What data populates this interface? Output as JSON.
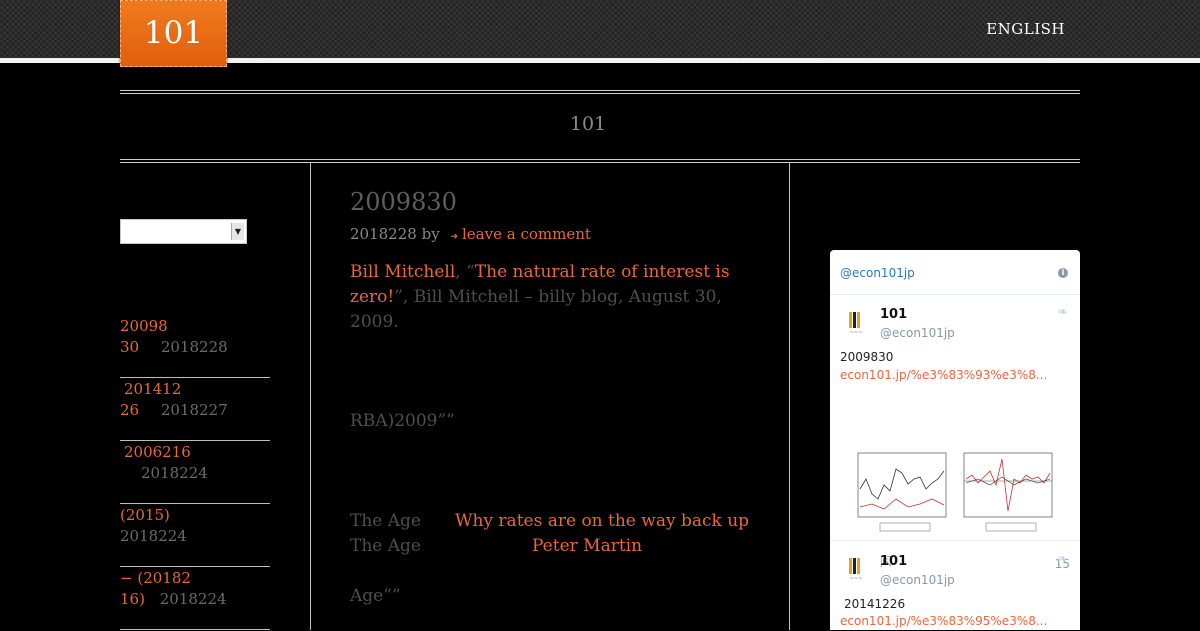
{
  "header": {
    "logo_text": "101",
    "language_link": "ENGLISH"
  },
  "site": {
    "title": "101"
  },
  "sidebar": {
    "categories_select": "",
    "recent_posts": [
      {
        "line1": "20098",
        "line2": "30",
        "date": "2018228"
      },
      {
        "line1": "201412",
        "line2": "26",
        "date": "2018227"
      },
      {
        "line1": "2006216",
        "line2": "",
        "date": "2018224"
      },
      {
        "line1": "(2015)",
        "line2": "",
        "date": "2018224"
      },
      {
        "line1": "− (20182",
        "line2": "16)",
        "date": "2018224"
      }
    ]
  },
  "post": {
    "title": "2009830",
    "meta_date": "2018228",
    "meta_by": "by",
    "meta_comment": "leave a comment",
    "p1_author": "Bill Mitchell",
    "p1_sep": ", “",
    "p1_link": "The natural rate of interest is zero!",
    "p1_rest": "”, Bill Mitchell – billy blog, August 30, 2009.",
    "p2": "RBA)2009””",
    "p3_source1": "The Age",
    "p3_link1": "Why rates are on the way back up",
    "p3_source2": "The Age",
    "p3_link2": "Peter Martin",
    "p4": "Age””"
  },
  "twitter": {
    "header_handle": "@econ101jp",
    "tweets": [
      {
        "name": "101",
        "handle": "@econ101jp",
        "text": "2009830",
        "link": "econ101.jp/%e3%83%93%e3%8...",
        "likes": "15"
      },
      {
        "name": "101",
        "handle": "@econ101jp",
        "text": "20141226",
        "link": "econ101.jp/%e3%83%95%e3%8..."
      }
    ]
  },
  "colors": {
    "accent": "#e8673c",
    "logo_orange": "#e86a16",
    "twitter_blue": "#2b7bb9"
  },
  "icons": [
    "pin-icon",
    "info-icon",
    "twitter-bird-icon",
    "heart-icon",
    "share-icon",
    "dropdown-arrow-icon"
  ]
}
